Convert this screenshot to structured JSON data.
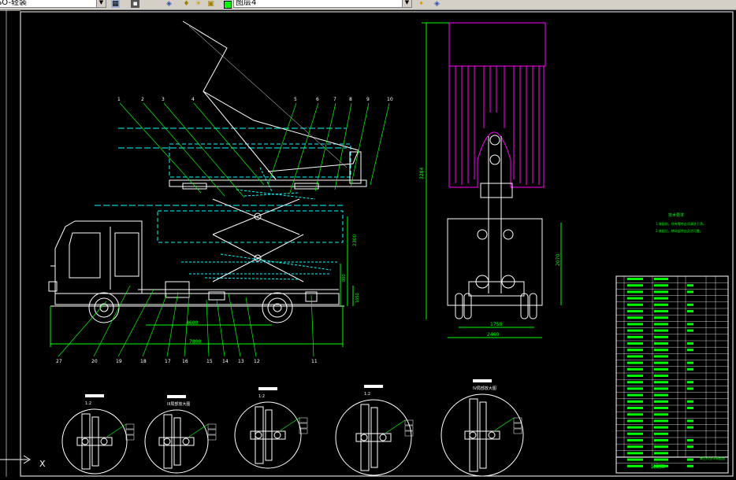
{
  "toolbar": {
    "style_combo": "ISO-轻装",
    "layer_combo": "图层4",
    "icons": [
      "layer-properties-icon",
      "layer-previous-icon",
      "bulb-on-icon",
      "sun-icon",
      "lock-icon",
      "color-swatch-icon",
      "make-current-icon",
      "layer-states-icon"
    ]
  },
  "drawing": {
    "part_numbers_top": [
      "1",
      "2",
      "3",
      "4",
      "5",
      "6",
      "7",
      "8",
      "9",
      "10"
    ],
    "part_numbers_bottom": [
      "27",
      "20",
      "19",
      "18",
      "17",
      "16",
      "15",
      "14",
      "13",
      "12",
      "11"
    ],
    "dimensions": {
      "length_inner": "4600",
      "length_total": "7800",
      "height_lift": "2300",
      "height_total": "3284",
      "rear_width": "2460",
      "rear_track": "1750",
      "rear_height": "2070",
      "side_small": "800",
      "side_small2": "1050"
    },
    "detail_labels": [
      "1:2",
      "III局部放大图",
      "1:2",
      "1:2",
      "IV局部放大图"
    ],
    "detail_scales": [
      "1:2",
      "1:2",
      "1:2",
      "1:2",
      "1:2"
    ],
    "tech_req_title": "技术要求",
    "tech_req_lines": [
      "1.装配前，所有零件必须清洗干净。",
      "2.装配后，转动部件应灵活可靠。"
    ],
    "title_block_name": "装配图",
    "title_block_sub": "高空作业车装配图",
    "ucs_axis_label": "X"
  }
}
